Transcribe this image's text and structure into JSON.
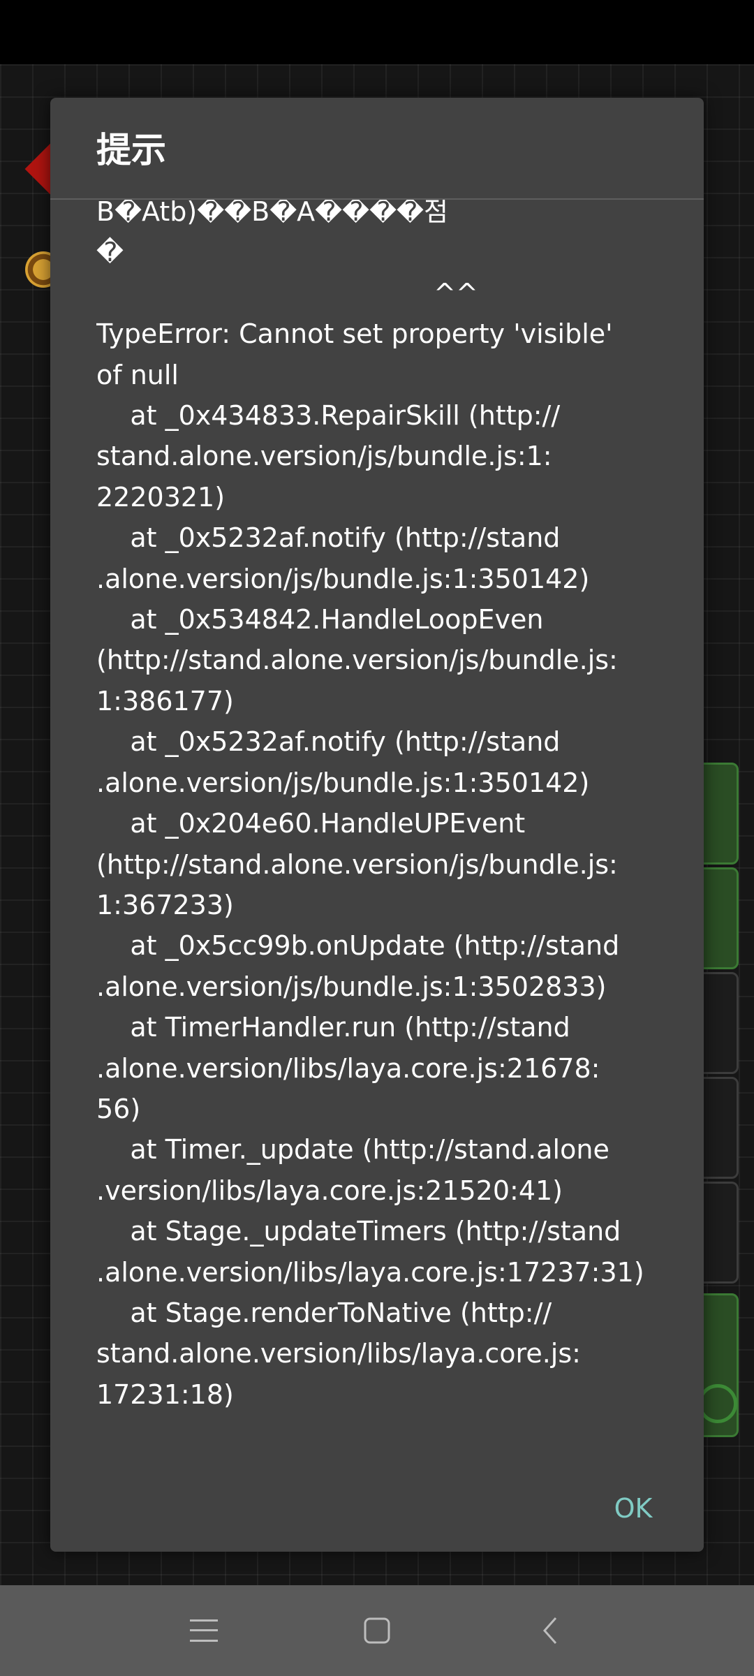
{
  "dialog": {
    "title": "提示",
    "message_lines": [
      "B�Atb)��B�A����점",
      "�",
      "                                        ^^",
      "TypeError: Cannot set property 'visible'",
      "of null",
      "    at _0x434833.RepairSkill (http://",
      "stand.alone.version/js/bundle.js:1:",
      "2220321)",
      "    at _0x5232af.notify (http://stand",
      ".alone.version/js/bundle.js:1:350142)",
      "    at _0x534842.HandleLoopEven",
      "(http://stand.alone.version/js/bundle.js:",
      "1:386177)",
      "    at _0x5232af.notify (http://stand",
      ".alone.version/js/bundle.js:1:350142)",
      "    at _0x204e60.HandleUPEvent",
      "(http://stand.alone.version/js/bundle.js:",
      "1:367233)",
      "    at _0x5cc99b.onUpdate (http://stand",
      ".alone.version/js/bundle.js:1:3502833)",
      "    at TimerHandler.run (http://stand",
      ".alone.version/libs/laya.core.js:21678:",
      "56)",
      "    at Timer._update (http://stand.alone",
      ".version/libs/laya.core.js:21520:41)",
      "    at Stage._updateTimers (http://stand",
      ".alone.version/libs/laya.core.js:17237:31)",
      "    at Stage.renderToNative (http://",
      "stand.alone.version/libs/laya.core.js:",
      "17231:18)"
    ],
    "ok_label": "OK"
  },
  "nav_bar": {
    "icons": [
      "menu-icon",
      "home-square-icon",
      "back-chevron-icon"
    ]
  },
  "colors": {
    "dialog_bg": "#424242",
    "accent": "#80cbc4",
    "nav_bar_bg": "#5a5a5a"
  }
}
